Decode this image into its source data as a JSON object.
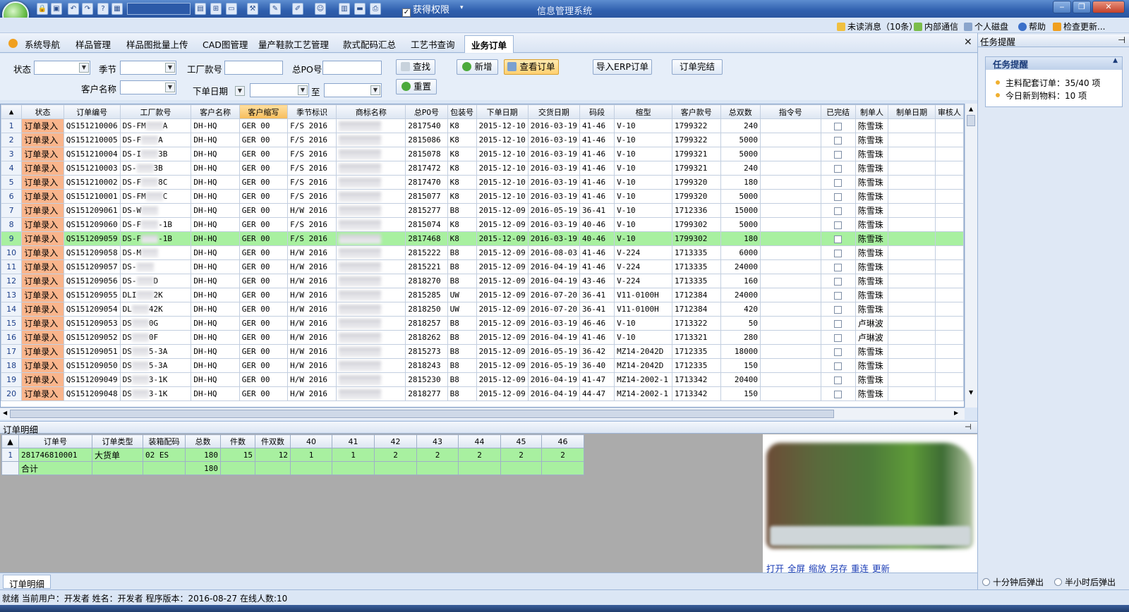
{
  "app": {
    "title": "信息管理系统",
    "perm_label": "获得权限"
  },
  "toprow": {
    "unread": "未读消息（10条）",
    "internal": "内部通信",
    "disk": "个人磁盘",
    "help": "帮助",
    "update": "检查更新...",
    "task_panel_title": "任务提醒"
  },
  "nav": {
    "tabs": [
      "系统导航",
      "样品管理",
      "样品图批量上传",
      "CAD图管理",
      "量产鞋款工艺管理",
      "款式配码汇总",
      "工艺书查询",
      "业务订单"
    ],
    "active": "业务订单"
  },
  "filter": {
    "status_label": "状态",
    "season_label": "季节",
    "factory_no_label": "工厂款号",
    "po_label": "总PO号",
    "customer_label": "客户名称",
    "order_date_label": "下单日期",
    "to_label": "至",
    "find": "查找",
    "reset": "重置",
    "add": "新增",
    "view": "查看订单",
    "import": "导入ERP订单",
    "complete": "订单完结"
  },
  "grid": {
    "headers": [
      "状态",
      "订单编号",
      "工厂款号",
      "客户名称",
      "客户缩写",
      "季节标识",
      "商标名称",
      "总PO号",
      "包装号",
      "下单日期",
      "交货日期",
      "码段",
      "楦型",
      "客户款号",
      "总双数",
      "指令号",
      "已完结",
      "制单人",
      "制单日期",
      "审核人"
    ],
    "rows": [
      [
        "订单录入",
        "QS151210006",
        "DS-FM",
        "A",
        "DH-HQ",
        "GER 00",
        "F/S 2016",
        "2817540",
        "K8",
        "2015-12-10",
        "2016-03-19",
        "41-46",
        "V-10",
        "1799322",
        "240",
        "陈雪珠"
      ],
      [
        "订单录入",
        "QS151210005",
        "DS-F",
        "A",
        "DH-HQ",
        "GER 00",
        "F/S 2016",
        "2815086",
        "K8",
        "2015-12-10",
        "2016-03-19",
        "41-46",
        "V-10",
        "1799322",
        "5000",
        "陈雪珠"
      ],
      [
        "订单录入",
        "QS151210004",
        "DS-I",
        "3B",
        "DH-HQ",
        "GER 00",
        "F/S 2016",
        "2815078",
        "K8",
        "2015-12-10",
        "2016-03-19",
        "41-46",
        "V-10",
        "1799321",
        "5000",
        "陈雪珠"
      ],
      [
        "订单录入",
        "QS151210003",
        "DS-",
        "3B",
        "DH-HQ",
        "GER 00",
        "F/S 2016",
        "2817472",
        "K8",
        "2015-12-10",
        "2016-03-19",
        "41-46",
        "V-10",
        "1799321",
        "240",
        "陈雪珠"
      ],
      [
        "订单录入",
        "QS151210002",
        "DS-F",
        "8C",
        "DH-HQ",
        "GER 00",
        "F/S 2016",
        "2817470",
        "K8",
        "2015-12-10",
        "2016-03-19",
        "41-46",
        "V-10",
        "1799320",
        "180",
        "陈雪珠"
      ],
      [
        "订单录入",
        "QS151210001",
        "DS-FM",
        "C",
        "DH-HQ",
        "GER 00",
        "F/S 2016",
        "2815077",
        "K8",
        "2015-12-10",
        "2016-03-19",
        "41-46",
        "V-10",
        "1799320",
        "5000",
        "陈雪珠"
      ],
      [
        "订单录入",
        "QS151209061",
        "DS-W",
        "",
        "DH-HQ",
        "GER 00",
        "H/W 2016",
        "2815277",
        "B8",
        "2015-12-09",
        "2016-05-19",
        "36-41",
        "V-10",
        "1712336",
        "15000",
        "陈雪珠"
      ],
      [
        "订单录入",
        "QS151209060",
        "DS-F",
        "-1B",
        "DH-HQ",
        "GER 00",
        "F/S 2016",
        "2815074",
        "K8",
        "2015-12-09",
        "2016-03-19",
        "40-46",
        "V-10",
        "1799302",
        "5000",
        "陈雪珠"
      ],
      [
        "订单录入",
        "QS151209059",
        "DS-F",
        "-1B",
        "DH-HQ",
        "GER 00",
        "F/S 2016",
        "2817468",
        "K8",
        "2015-12-09",
        "2016-03-19",
        "40-46",
        "V-10",
        "1799302",
        "180",
        "陈雪珠"
      ],
      [
        "订单录入",
        "QS151209058",
        "DS-M",
        "",
        "DH-HQ",
        "GER 00",
        "H/W 2016",
        "2815222",
        "B8",
        "2015-12-09",
        "2016-08-03",
        "41-46",
        "V-224",
        "1713335",
        "6000",
        "陈雪珠"
      ],
      [
        "订单录入",
        "QS151209057",
        "DS-",
        "",
        "DH-HQ",
        "GER 00",
        "H/W 2016",
        "2815221",
        "B8",
        "2015-12-09",
        "2016-04-19",
        "41-46",
        "V-224",
        "1713335",
        "24000",
        "陈雪珠"
      ],
      [
        "订单录入",
        "QS151209056",
        "DS-",
        "D",
        "DH-HQ",
        "GER 00",
        "H/W 2016",
        "2818270",
        "B8",
        "2015-12-09",
        "2016-04-19",
        "43-46",
        "V-224",
        "1713335",
        "160",
        "陈雪珠"
      ],
      [
        "订单录入",
        "QS151209055",
        "DLI",
        "2K",
        "DH-HQ",
        "GER 00",
        "H/W 2016",
        "2815285",
        "UW",
        "2015-12-09",
        "2016-07-20",
        "36-41",
        "V11-0100H",
        "1712384",
        "24000",
        "陈雪珠"
      ],
      [
        "订单录入",
        "QS151209054",
        "DL",
        "42K",
        "DH-HQ",
        "GER 00",
        "H/W 2016",
        "2818250",
        "UW",
        "2015-12-09",
        "2016-07-20",
        "36-41",
        "V11-0100H",
        "1712384",
        "420",
        "陈雪珠"
      ],
      [
        "订单录入",
        "QS151209053",
        "DS",
        "0G",
        "DH-HQ",
        "GER 00",
        "H/W 2016",
        "2818257",
        "B8",
        "2015-12-09",
        "2016-03-19",
        "46-46",
        "V-10",
        "1713322",
        "50",
        "卢琳波"
      ],
      [
        "订单录入",
        "QS151209052",
        "DS",
        "0F",
        "DH-HQ",
        "GER 00",
        "H/W 2016",
        "2818262",
        "B8",
        "2015-12-09",
        "2016-04-19",
        "41-46",
        "V-10",
        "1713321",
        "280",
        "卢琳波"
      ],
      [
        "订单录入",
        "QS151209051",
        "DS",
        "5-3A",
        "DH-HQ",
        "GER 00",
        "H/W 2016",
        "2815273",
        "B8",
        "2015-12-09",
        "2016-05-19",
        "36-42",
        "MZ14-2042D",
        "1712335",
        "18000",
        "陈雪珠"
      ],
      [
        "订单录入",
        "QS151209050",
        "DS",
        "5-3A",
        "DH-HQ",
        "GER 00",
        "H/W 2016",
        "2818243",
        "B8",
        "2015-12-09",
        "2016-05-19",
        "36-40",
        "MZ14-2042D",
        "1712335",
        "150",
        "陈雪珠"
      ],
      [
        "订单录入",
        "QS151209049",
        "DS",
        "3-1K",
        "DH-HQ",
        "GER 00",
        "H/W 2016",
        "2815230",
        "B8",
        "2015-12-09",
        "2016-04-19",
        "41-47",
        "MZ14-2002-1",
        "1713342",
        "20400",
        "陈雪珠"
      ],
      [
        "订单录入",
        "QS151209048",
        "DS",
        "3-1K",
        "DH-HQ",
        "GER 00",
        "H/W 2016",
        "2818277",
        "B8",
        "2015-12-09",
        "2016-04-19",
        "44-47",
        "MZ14-2002-1",
        "1713342",
        "150",
        "陈雪珠"
      ]
    ],
    "selected_row": 9
  },
  "detail": {
    "title": "订单明细",
    "headers": [
      "订单号",
      "订单类型",
      "装箱配码",
      "总数",
      "件数",
      "件双数",
      "40",
      "41",
      "42",
      "43",
      "44",
      "45",
      "46"
    ],
    "row": [
      "281746810001",
      "大货单",
      "02 ES",
      "180",
      "15",
      "12",
      "1",
      "1",
      "2",
      "2",
      "2",
      "2",
      "2"
    ],
    "total_label": "合计",
    "total_value": "180",
    "image_links": [
      "打开",
      "全屏",
      "缩放",
      "另存",
      "重连",
      "更新"
    ]
  },
  "bottom_tab": "订单明细",
  "task": {
    "header": "任务提醒",
    "items": [
      "主料配套订单：35/40 项",
      "今日新到物料：10 项"
    ],
    "radio1": "十分钟后弹出",
    "radio2": "半小时后弹出"
  },
  "status": "就绪  当前用户：开发者  姓名：开发者  程序版本：2016-08-27  在线人数:10"
}
